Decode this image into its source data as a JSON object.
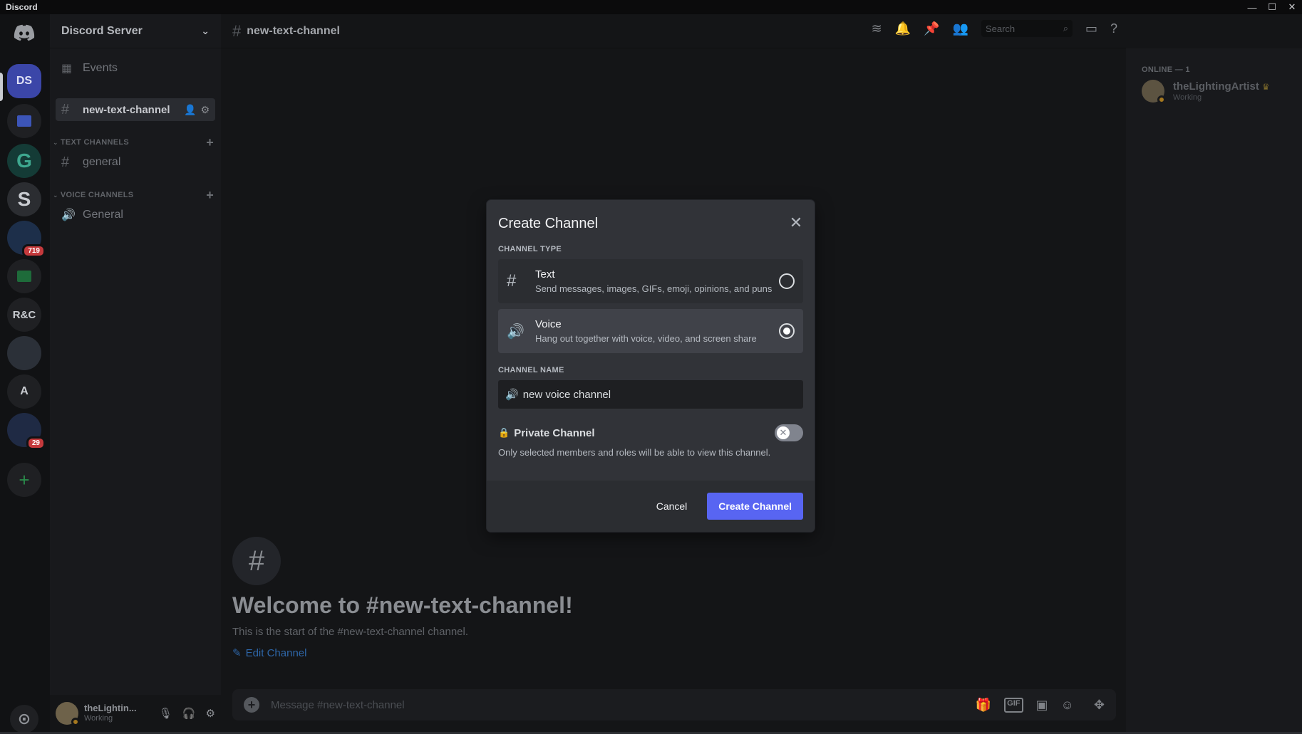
{
  "window": {
    "app_name": "Discord",
    "minimize": "—",
    "maximize": "☐",
    "close": "✕"
  },
  "rail": {
    "home_icon": "discord-logo-icon",
    "servers": [
      {
        "label": "DS",
        "active": true
      },
      {
        "label": ""
      },
      {
        "label": "G"
      },
      {
        "label": "S"
      },
      {
        "label": "",
        "badge": "719"
      },
      {
        "label": ""
      },
      {
        "label": "R&C"
      },
      {
        "label": ""
      },
      {
        "label": "A"
      },
      {
        "label": "",
        "badge": "29"
      }
    ],
    "add_server": "+",
    "explore": "⊙"
  },
  "sidebar": {
    "server_name": "Discord Server",
    "events": "Events",
    "selected_channel": "new-text-channel",
    "categories": [
      {
        "name": "TEXT CHANNELS",
        "channels": [
          "general"
        ]
      },
      {
        "name": "VOICE CHANNELS",
        "channels": [
          "General"
        ]
      }
    ]
  },
  "user": {
    "name": "theLightin...",
    "status": "Working"
  },
  "header": {
    "channel": "new-text-channel",
    "search_placeholder": "Search"
  },
  "welcome": {
    "title": "Welcome to #new-text-channel!",
    "subtitle": "This is the start of the #new-text-channel channel.",
    "edit": "Edit Channel"
  },
  "composer": {
    "placeholder": "Message #new-text-channel"
  },
  "members": {
    "category": "ONLINE — 1",
    "list": [
      {
        "name": "theLightingArtist",
        "status": "Working"
      }
    ]
  },
  "modal": {
    "title": "Create Channel",
    "type_label": "CHANNEL TYPE",
    "types": [
      {
        "name": "Text",
        "desc": "Send messages, images, GIFs, emoji, opinions, and puns",
        "selected": false
      },
      {
        "name": "Voice",
        "desc": "Hang out together with voice, video, and screen share",
        "selected": true
      }
    ],
    "name_label": "CHANNEL NAME",
    "name_value": "new voice channel",
    "private_label": "Private Channel",
    "private_on": false,
    "private_help": "Only selected members and roles will be able to view this channel.",
    "cancel": "Cancel",
    "create": "Create Channel"
  },
  "colors": {
    "accent": "#5865f2",
    "danger": "#c53a3d",
    "modal_bg": "#313338"
  }
}
